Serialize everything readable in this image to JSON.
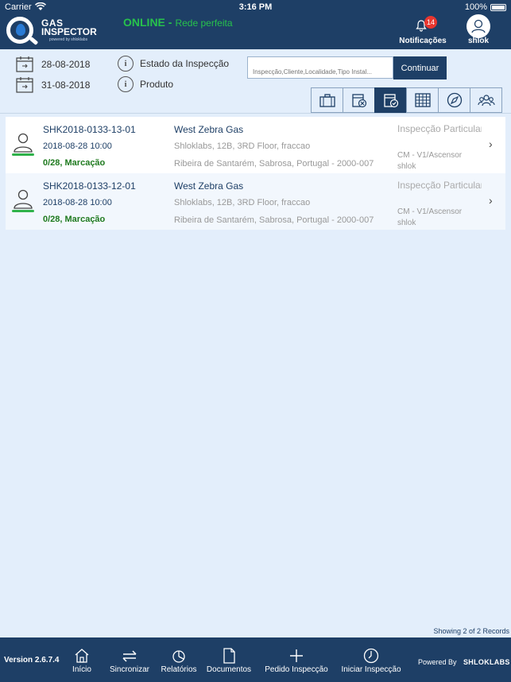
{
  "status_bar": {
    "carrier": "Carrier",
    "time": "3:16 PM",
    "battery": "100%"
  },
  "header": {
    "logo_line1": "GAS",
    "logo_line2": "INSPECTOR",
    "logo_line3": "powered by shloklabs",
    "online": "ONLINE -",
    "network": "Rede perfeita",
    "notification_count": "14",
    "notifications_label": "Notificações",
    "user_label": "shlok"
  },
  "filters": {
    "date_from": "28-08-2018",
    "date_to": "31-08-2018",
    "state_label": "Estado da Inspecção",
    "product_label": "Produto",
    "search_placeholder": "Inspecção,Cliente,Localidade,Tipo Instal...",
    "continue_label": "Continuar"
  },
  "view_buttons": [
    {
      "icon": "briefcase-icon",
      "active": false
    },
    {
      "icon": "calendar-cancel-icon",
      "active": false
    },
    {
      "icon": "calendar-check-icon",
      "active": true
    },
    {
      "icon": "grid-icon",
      "active": false
    },
    {
      "icon": "compass-icon",
      "active": false
    },
    {
      "icon": "group-icon",
      "active": false
    }
  ],
  "inspections": [
    {
      "code": "SHK2018-0133-13-01",
      "datetime": "2018-08-28 10:00",
      "status": "0/28, Marcação",
      "client": "West Zebra Gas",
      "address1": "Shloklabs, 12B, 3RD Floor, fraccao",
      "address2": "Ribeira de Santarém, Sabrosa, Portugal - 2000-007",
      "type": "Inspecção Particular",
      "model": "CM - V1/Ascensor",
      "owner": "shlok"
    },
    {
      "code": "SHK2018-0133-12-01",
      "datetime": "2018-08-28 10:00",
      "status": "0/28, Marcação",
      "client": "West Zebra Gas",
      "address1": "Shloklabs, 12B, 3RD Floor, fraccao",
      "address2": "Ribeira de Santarém, Sabrosa, Portugal - 2000-007",
      "type": "Inspecção Particular",
      "model": "CM - V1/Ascensor",
      "owner": "shlok"
    }
  ],
  "records_text": "Showing 2 of 2 Records",
  "footer": {
    "version": "Version 2.6.7.4",
    "nav": {
      "home": "Início",
      "sync": "Sincronizar",
      "reports": "Relatórios",
      "documents": "Documentos",
      "request": "Pedido Inspecção",
      "start": "Iniciar Inspecção"
    },
    "powered": "Powered By",
    "brand": "SHLOKLABS"
  },
  "colors": {
    "primary": "#1e3f66",
    "online": "#27c24c",
    "badge": "#e8362f",
    "status_green": "#1f7a1f",
    "background": "#e3eefb"
  }
}
